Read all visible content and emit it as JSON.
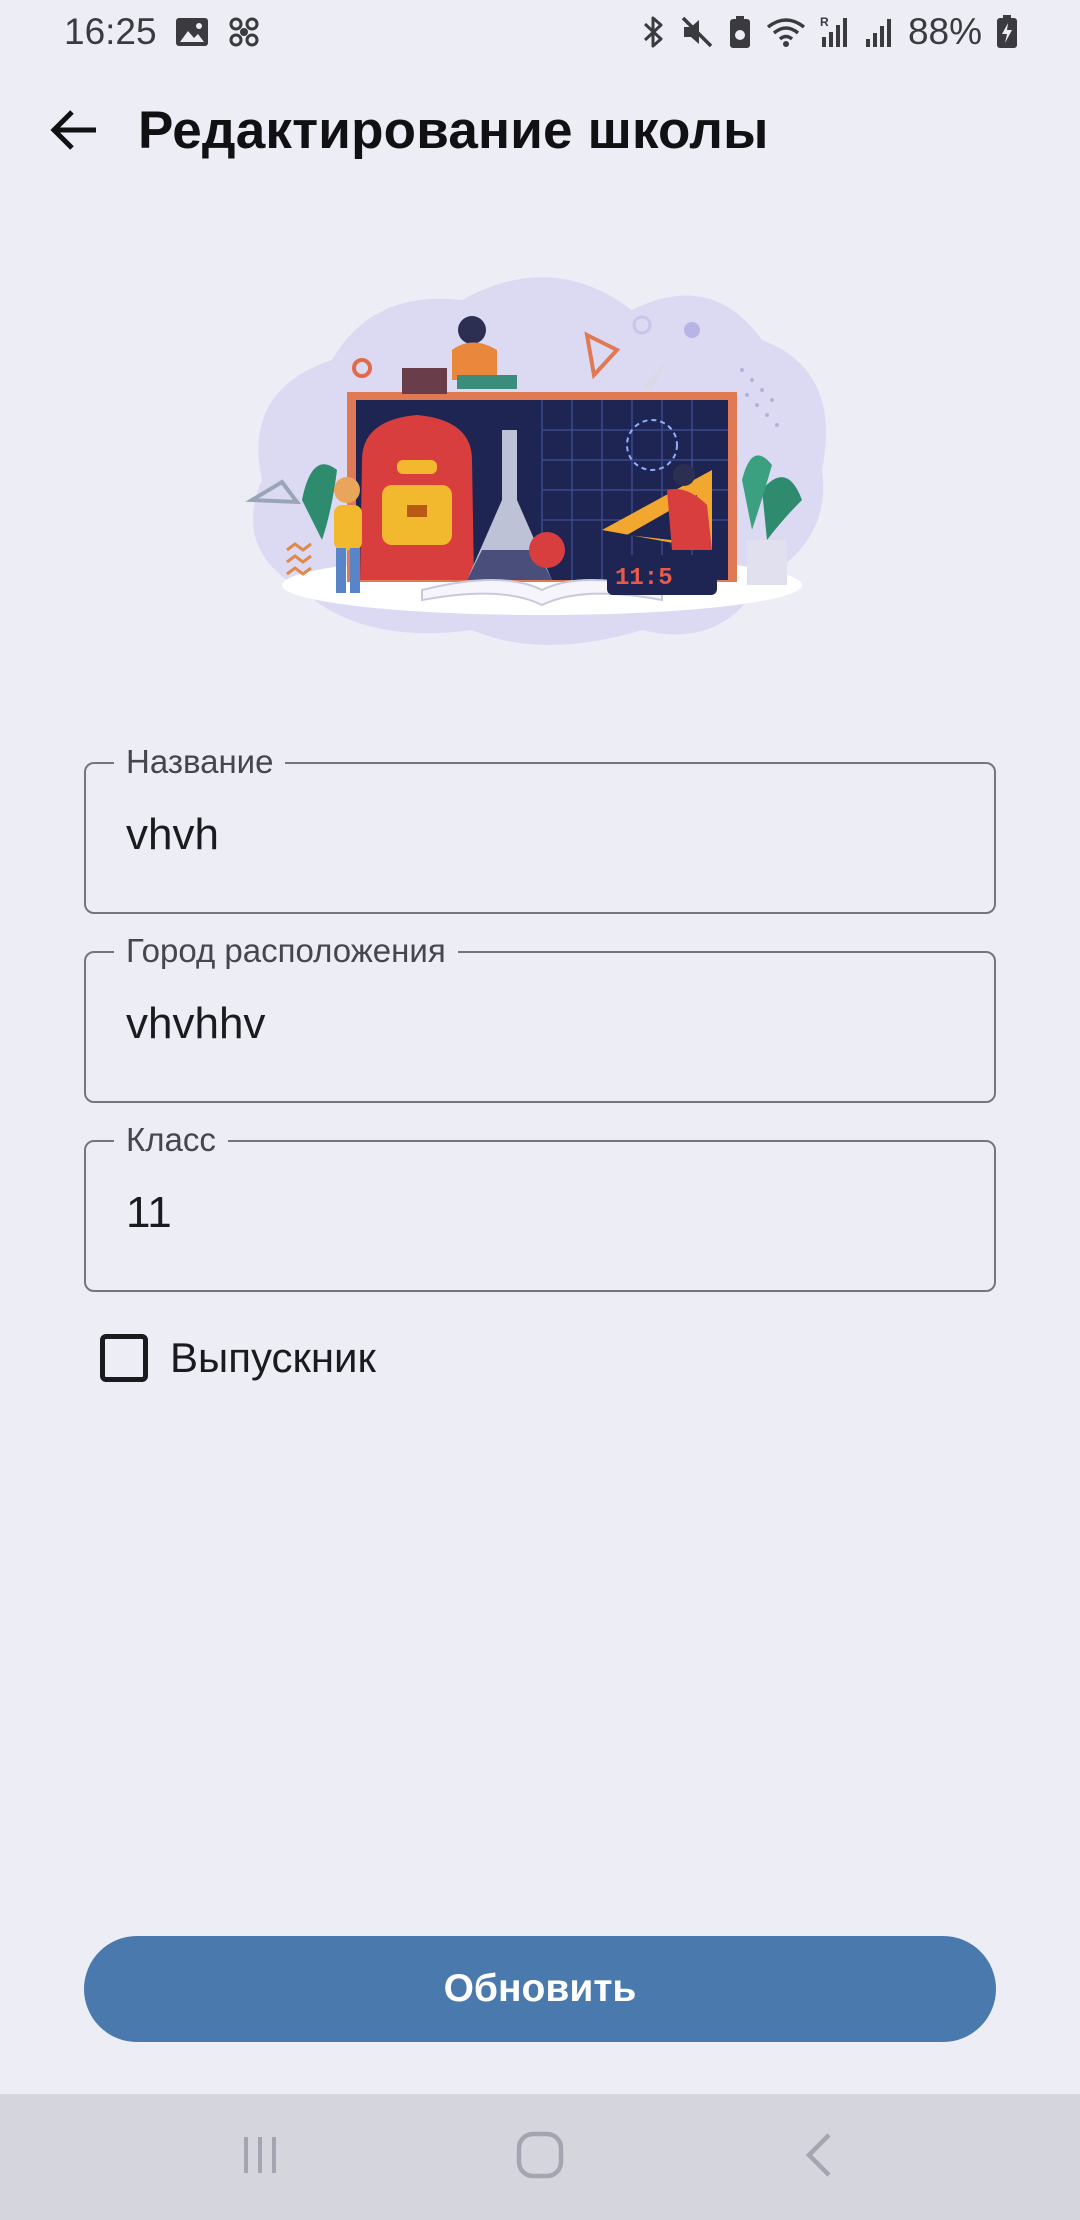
{
  "status_bar": {
    "time": "16:25",
    "battery_percent": "88%",
    "icons_left": [
      "image-icon",
      "fan-icon"
    ],
    "icons_right": [
      "bluetooth-icon",
      "mute-icon",
      "battery-saver-icon",
      "wifi-icon",
      "signal-roaming-icon",
      "signal-icon",
      "battery-charging-icon"
    ]
  },
  "app_bar": {
    "title": "Редактирование школы",
    "back_icon": "arrow-left-icon"
  },
  "hero": {
    "description_icon": "school-illustration",
    "clock_digits": "11:5"
  },
  "form": {
    "name": {
      "label": "Название",
      "value": "vhvh"
    },
    "city": {
      "label": "Город расположения",
      "value": "vhvhhv"
    },
    "grade": {
      "label": "Класс",
      "value": "11"
    },
    "graduate": {
      "label": "Выпускник",
      "checked": false
    }
  },
  "actions": {
    "update_label": "Обновить"
  },
  "colors": {
    "background": "#ecedf5",
    "primary_button": "#4a7aad",
    "outline": "#74757f",
    "nav_bar": "#d4d5dd"
  },
  "nav": {
    "items": [
      "recents-icon",
      "home-icon",
      "back-icon"
    ]
  }
}
